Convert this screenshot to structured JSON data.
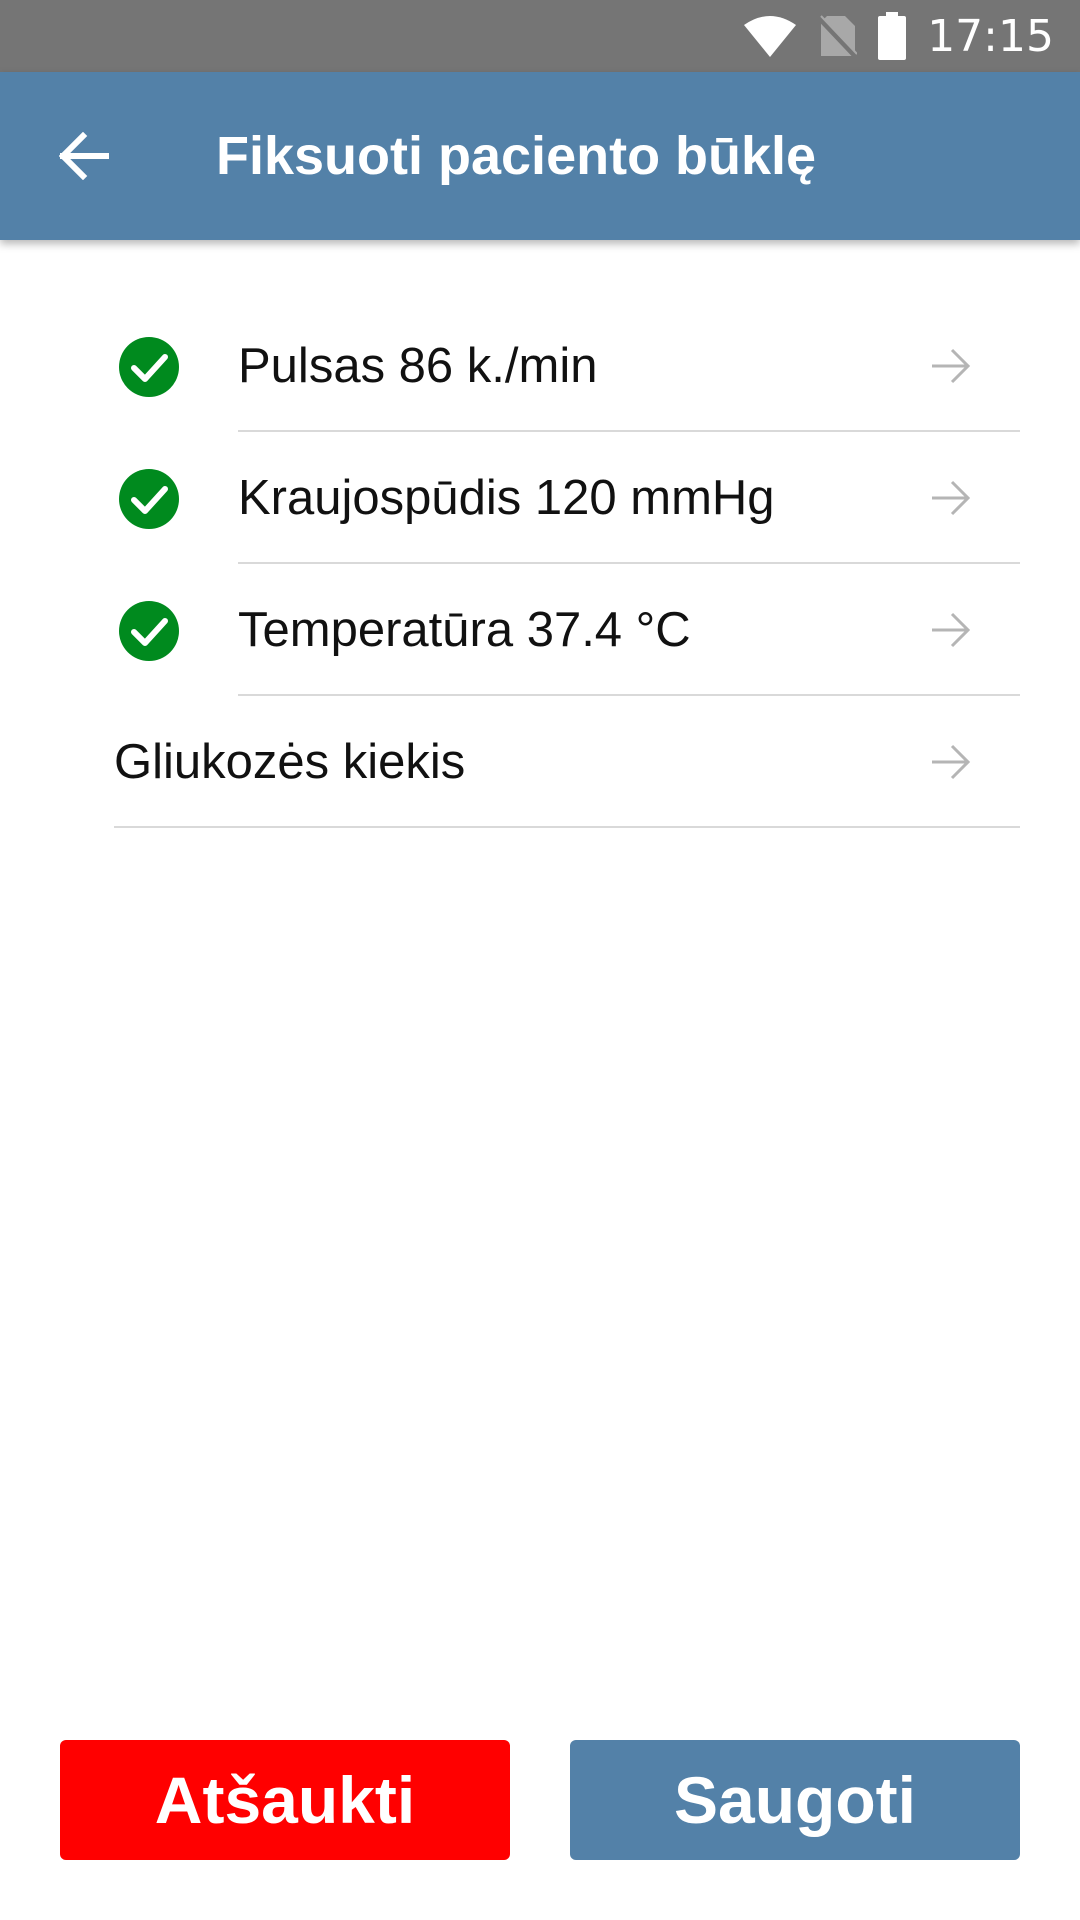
{
  "status_bar": {
    "time": "17:15",
    "icons": [
      "wifi-icon",
      "no-sim-icon",
      "battery-icon"
    ]
  },
  "app_bar": {
    "back_icon": "arrow-left-icon",
    "title": "Fiksuoti paciento būklę"
  },
  "list": {
    "items": [
      {
        "label": "Pulsas 86 k./min",
        "completed": true
      },
      {
        "label": "Kraujospūdis 120 mmHg",
        "completed": true
      },
      {
        "label": "Temperatūra 37.4 °C",
        "completed": true
      },
      {
        "label": "Gliukozės kiekis",
        "completed": false
      }
    ]
  },
  "buttons": {
    "cancel_label": "Atšaukti",
    "save_label": "Saugoti"
  },
  "colors": {
    "status_bar": "#757575",
    "app_bar": "#5381a8",
    "check_green": "#008a1e",
    "cancel_red": "#ff0000",
    "save_blue": "#5381a8"
  }
}
